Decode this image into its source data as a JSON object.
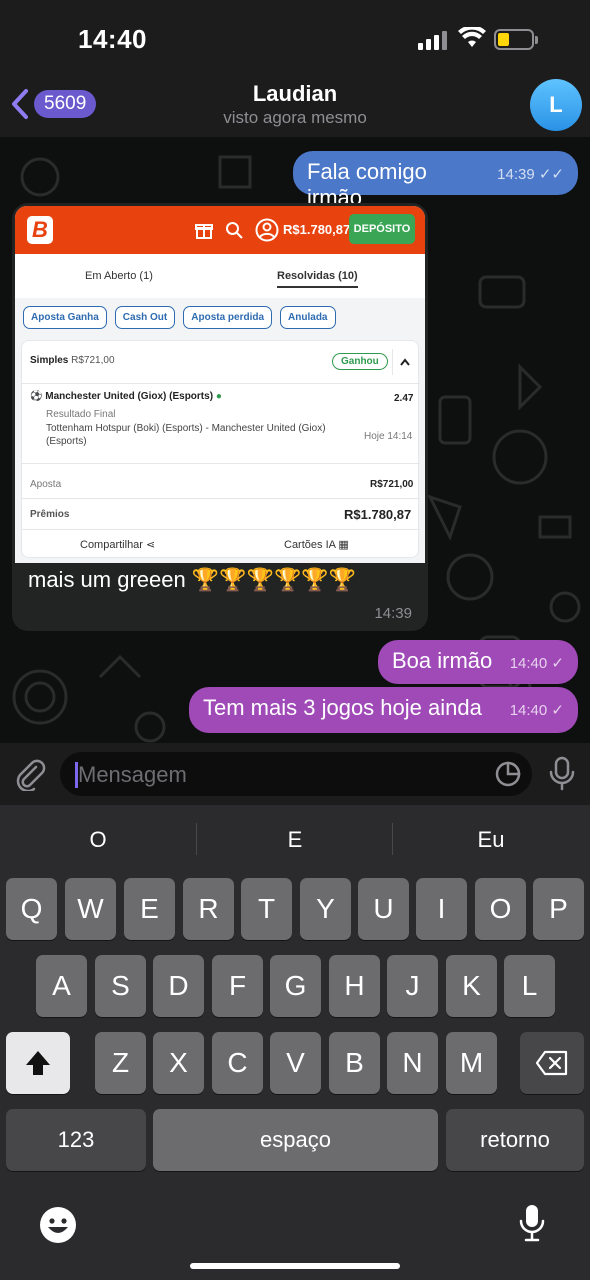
{
  "status_bar": {
    "time": "14:40"
  },
  "header": {
    "back_count": "5609",
    "contact_name": "Laudian",
    "last_seen": "visto agora mesmo",
    "avatar_letter": "L"
  },
  "messages": {
    "out1": {
      "text": "Fala comigo irmão",
      "time": "14:39"
    },
    "in1": {
      "caption": "mais um greeen 🏆🏆🏆🏆🏆🏆",
      "time": "14:39"
    },
    "out2": {
      "text": "Boa irmão",
      "time": "14:40"
    },
    "out3": {
      "text": "Tem mais 3 jogos hoje ainda",
      "time": "14:40"
    }
  },
  "bet_screenshot": {
    "logo": "B",
    "balance": "R$1.780,87",
    "deposit_label": "DEPÓSITO",
    "tab_open": "Em Aberto (1)",
    "tab_resolved": "Resolvidas (10)",
    "chips": [
      "Aposta Ganha",
      "Cash Out",
      "Aposta perdida",
      "Anulada"
    ],
    "bet_type": "Simples",
    "bet_amount_inline": "R$721,00",
    "status": "Ganhou",
    "selection": "Manchester United (Giox) (Esports)",
    "odds": "2.47",
    "result_label": "Resultado Final",
    "match": "Tottenham Hotspur (Boki) (Esports) - Manchester United (Giox) (Esports)",
    "match_time": "Hoje 14:14",
    "stake_label": "Aposta",
    "stake_value": "R$721,00",
    "prize_label": "Prêmios",
    "prize_value": "R$1.780,87",
    "share_label": "Compartilhar",
    "cards_label": "Cartões IA"
  },
  "composer": {
    "placeholder": "Mensagem"
  },
  "keyboard": {
    "suggestions": [
      "O",
      "E",
      "Eu"
    ],
    "row1": [
      "Q",
      "W",
      "E",
      "R",
      "T",
      "Y",
      "U",
      "I",
      "O",
      "P"
    ],
    "row2": [
      "A",
      "S",
      "D",
      "F",
      "G",
      "H",
      "J",
      "K",
      "L"
    ],
    "row3": [
      "Z",
      "X",
      "C",
      "V",
      "B",
      "N",
      "M"
    ],
    "numbers_label": "123",
    "space_label": "espaço",
    "return_label": "retorno"
  },
  "colors": {
    "outgoing_blue": "#4b78c9",
    "outgoing_purple": "#a04ab8",
    "brand_orange": "#e8420f",
    "deposit_green": "#3aa655"
  }
}
